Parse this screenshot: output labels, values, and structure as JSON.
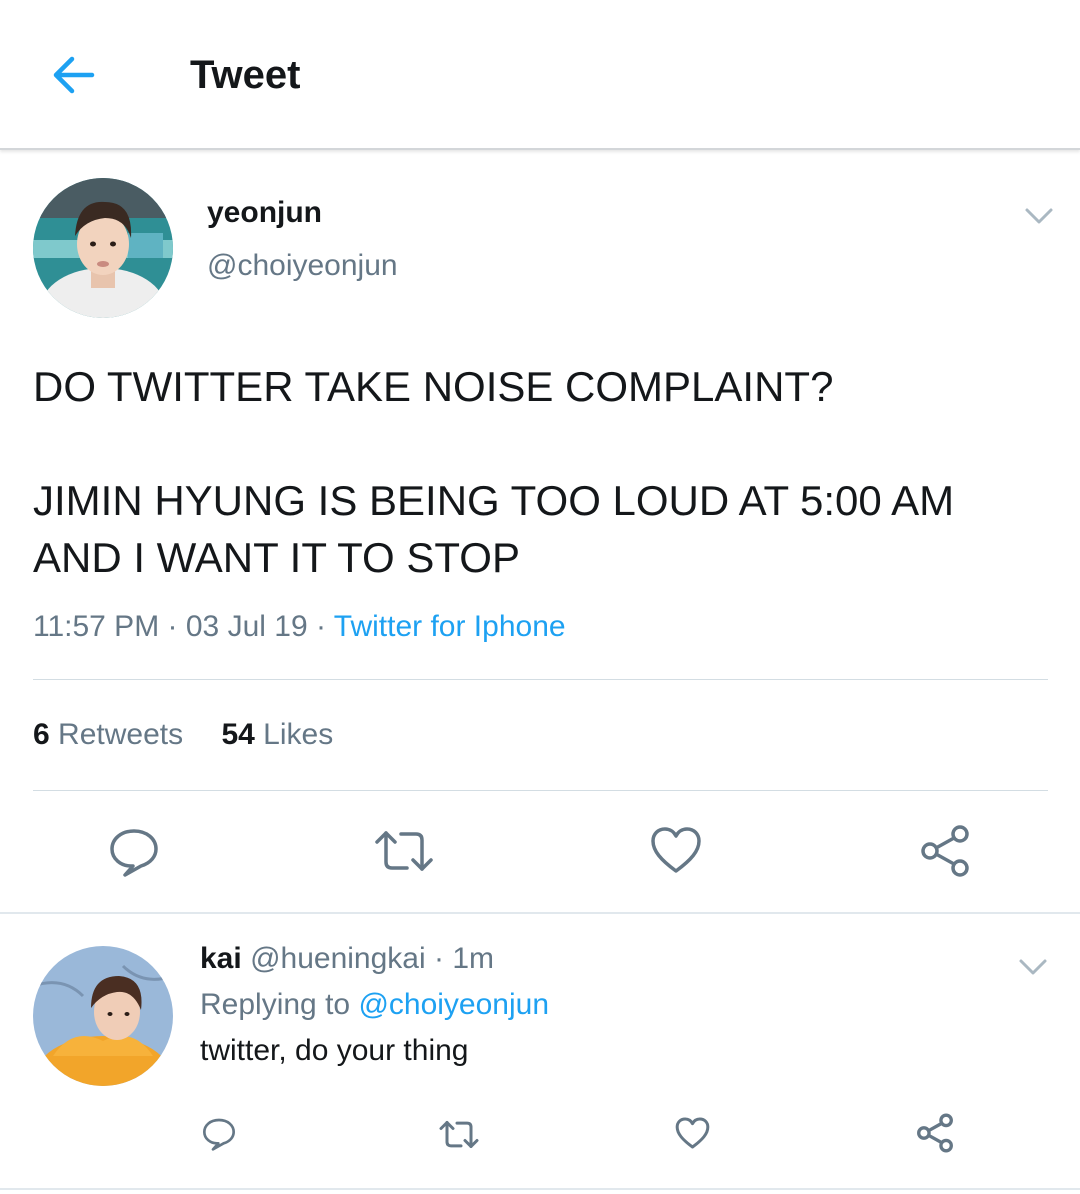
{
  "header": {
    "title": "Tweet",
    "back_icon": "arrow-left-icon",
    "accent": "#1da1f2"
  },
  "tweet": {
    "author_name": "yeonjun",
    "author_handle": "@choiyeonjun",
    "text_lines": [
      "DO TWITTER TAKE NOISE COMPLAINT?",
      "JIMIN HYUNG IS BEING TOO LOUD AT 5:00 AM",
      "AND I WANT IT TO STOP"
    ],
    "time": "11:57 PM",
    "date": "03 Jul 19",
    "separator": "·",
    "source": "Twitter for Iphone",
    "retweets_count": "6",
    "retweets_label": "Retweets",
    "likes_count": "54",
    "likes_label": "Likes",
    "actions": [
      "reply-icon",
      "retweet-icon",
      "like-icon",
      "share-icon"
    ]
  },
  "reply": {
    "author_name": "kai",
    "author_handle": "@hueningkai",
    "separator": "·",
    "time_ago": "1m",
    "replying_to_label": "Replying to",
    "replying_to_handle": "@choiyeonjun",
    "text": "twitter, do your thing"
  },
  "colors": {
    "text": "#14171a",
    "secondary": "#657786",
    "link": "#1da1f2",
    "icon": "#657786"
  }
}
